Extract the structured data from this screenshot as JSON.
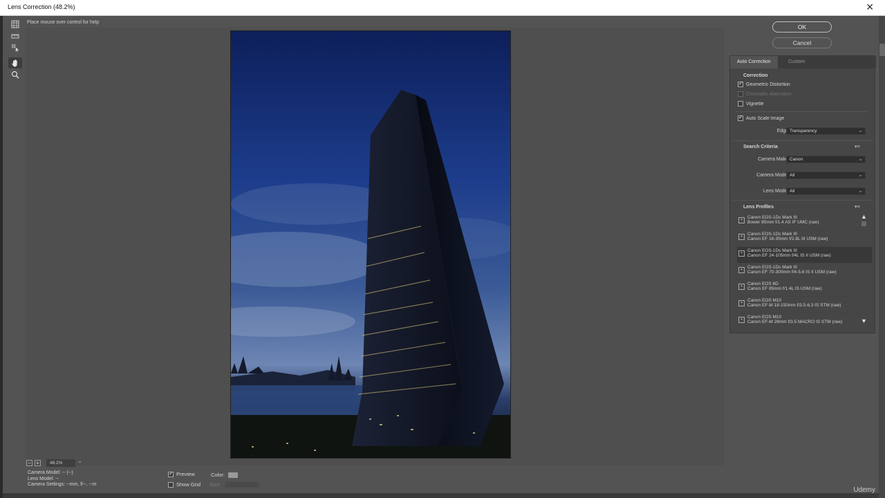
{
  "window": {
    "title": "Lens Correction (48.2%)",
    "close_glyph": "✕"
  },
  "help_text": "Place mouse over control for help",
  "tools": [
    {
      "name": "remove-distortion-tool-icon"
    },
    {
      "name": "straighten-tool-icon"
    },
    {
      "name": "move-grid-tool-icon"
    },
    {
      "name": "hand-tool-icon"
    },
    {
      "name": "zoom-tool-icon"
    }
  ],
  "zoom": {
    "minus": "−",
    "plus": "+",
    "value": "48.2%"
  },
  "info": {
    "camera_model": "Camera Model: -- (--)",
    "lens_model": "Lens Model: --",
    "camera_settings": "Camera Settings: --mm, f/--, --m"
  },
  "preview": {
    "preview_label": "Preview",
    "show_grid_label": "Show Grid",
    "color_label": "Color:",
    "size_label": "Size:"
  },
  "buttons": {
    "ok": "OK",
    "cancel": "Cancel"
  },
  "tabs": {
    "auto": "Auto Correction",
    "custom": "Custom"
  },
  "correction": {
    "title": "Correction",
    "geometric": "Geometric Distortion",
    "chromatic": "Chromatic Aberration",
    "vignette": "Vignette",
    "auto_scale": "Auto Scale Image",
    "edge_label": "Edge:",
    "edge_value": "Transparency"
  },
  "search": {
    "title": "Search Criteria",
    "make_label": "Camera Make:",
    "make_value": "Canon",
    "model_label": "Camera Model:",
    "model_value": "All",
    "lens_label": "Lens Model:",
    "lens_value": "All"
  },
  "profiles": {
    "title": "Lens Profiles",
    "items": [
      {
        "camera": "Canon EOS-1Ds Mark III",
        "lens": "Bower 85mm f/1.4 AS IF UMC (raw)"
      },
      {
        "camera": "Canon EOS-1Ds Mark III",
        "lens": "Canon EF 16-35mm f/2.8L III USM (raw)"
      },
      {
        "camera": "Canon EOS-1Ds Mark III",
        "lens": "Canon EF 24-105mm f/4L IS II USM (raw)"
      },
      {
        "camera": "Canon EOS-1Ds Mark III",
        "lens": "Canon EF 70-300mm f/4-5.6 IS II USM (raw)"
      },
      {
        "camera": "Canon EOS 6D",
        "lens": "Canon EF 85mm f/1.4L IS USM (raw)"
      },
      {
        "camera": "Canon EOS M10",
        "lens": "Canon EF-M 18-150mm f/3.5-6.3 IS STM (raw)"
      },
      {
        "camera": "Canon EOS M10",
        "lens": "Canon EF-M 28mm f/3.5 MACRO IS STM (raw)"
      }
    ]
  },
  "watermark": "Udemy"
}
